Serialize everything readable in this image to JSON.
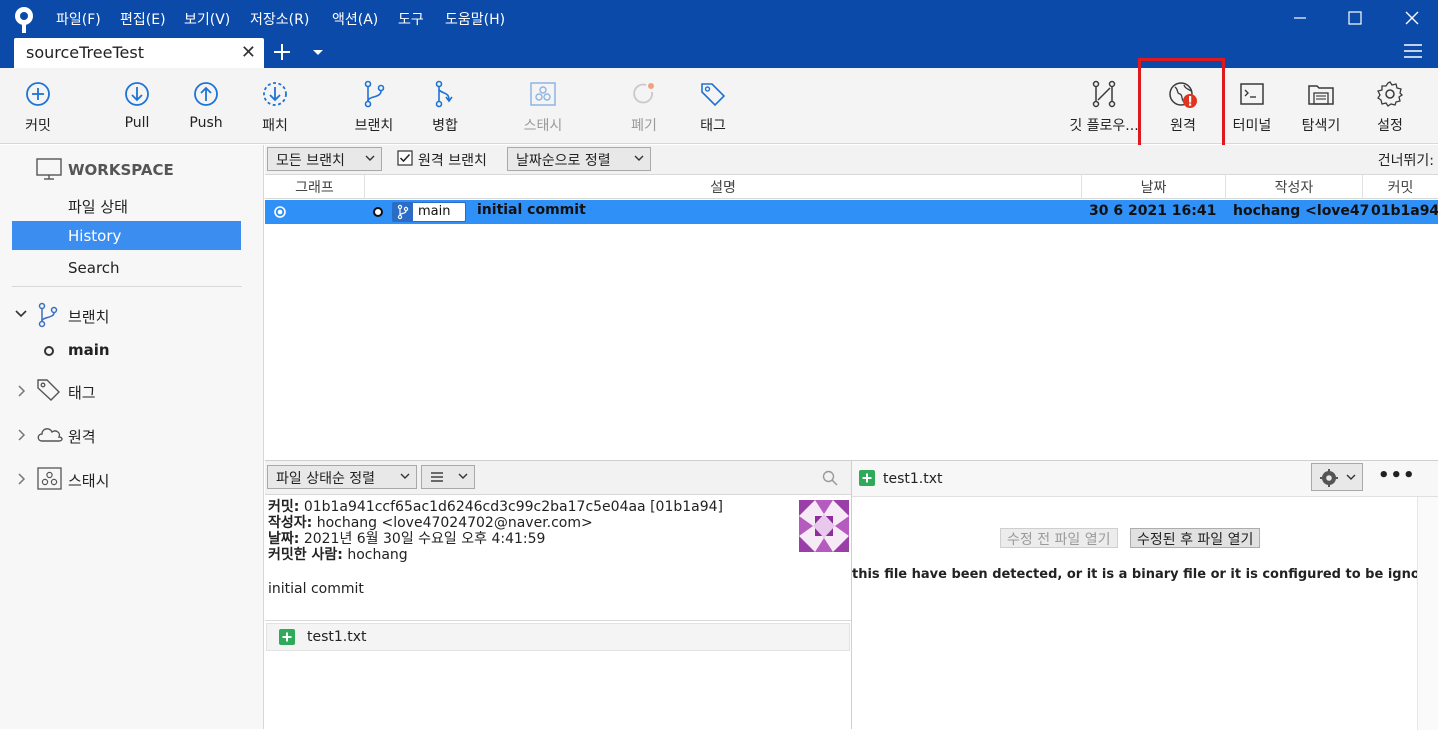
{
  "app": {
    "menu": [
      "파일(F)",
      "편집(E)",
      "보기(V)",
      "저장소(R)",
      "액션(A)",
      "도구",
      "도움말(H)"
    ],
    "tab_title": "sourceTreeTest"
  },
  "toolbar": {
    "commit": "커밋",
    "pull": "Pull",
    "push": "Push",
    "patch": "패치",
    "branch": "브랜치",
    "merge": "병합",
    "stash": "스태시",
    "discard": "폐기",
    "tag": "태그",
    "gitflow": "깃 플로우...",
    "remote": "원격",
    "terminal": "터미널",
    "explorer": "탐색기",
    "settings": "설정"
  },
  "sidebar": {
    "workspace": "WORKSPACE",
    "items": [
      "파일 상태",
      "History",
      "Search"
    ],
    "selected": "History",
    "branches_label": "브랜치",
    "branch_main": "main",
    "tags_label": "태그",
    "remotes_label": "원격",
    "stashes_label": "스태시"
  },
  "filters": {
    "branch_filter": "모든 브랜치",
    "remote_branches": "원격 브랜치",
    "sort": "날짜순으로 정렬",
    "skip": "건너뛰기:"
  },
  "columns": {
    "graph": "그래프",
    "description": "설명",
    "date": "날짜",
    "author": "작성자",
    "commit": "커밋"
  },
  "commits": [
    {
      "branch": "main",
      "message": "initial commit",
      "date": "30 6 2021 16:41",
      "author": "hochang <love47",
      "hash": "01b1a94"
    }
  ],
  "details": {
    "sort": "파일 상태순 정렬",
    "commit_label": "커밋:",
    "commit_value": "01b1a941ccf65ac1d6246cd3c99c2ba17c5e04aa [01b1a94]",
    "author_label": "작성자:",
    "author_value": "hochang <love47024702@naver.com>",
    "date_label": "날짜:",
    "date_value": "2021년 6월 30일 수요일 오후 4:41:59",
    "committer_label": "커밋한 사람:",
    "committer_value": "hochang",
    "message": "initial commit",
    "file": "test1.txt"
  },
  "diff": {
    "file": "test1.txt",
    "open_before": "수정 전 파일 열기",
    "open_after": "수정된 후 파일 열기",
    "notice": "this file have been detected, or it is a binary file or it is configured to be ignored by t"
  },
  "colors": {
    "titlebar": "#0b4aa8",
    "selection": "#2f90f7",
    "highlight": "#e0191e",
    "add": "#2faa5a"
  }
}
